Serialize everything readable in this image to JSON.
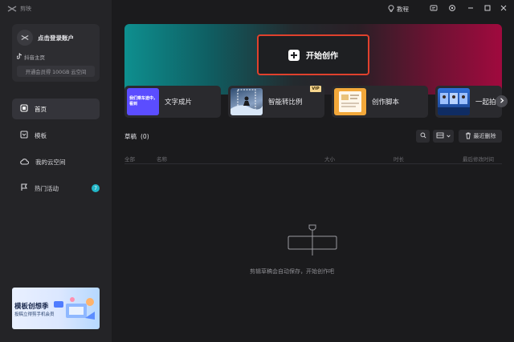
{
  "app": {
    "logo_text": "剪映"
  },
  "topbar": {
    "tutorial_label": "教程",
    "window_controls": [
      "minimize-icon",
      "maximize-icon",
      "close-icon"
    ]
  },
  "account": {
    "login_text": "点击登录账户",
    "douyin_label": "抖音主页",
    "vip_text": "开通会员得 100GB 云空间"
  },
  "nav": {
    "items": [
      {
        "label": "首页",
        "icon": "home-icon",
        "active": true
      },
      {
        "label": "模板",
        "icon": "template-icon",
        "active": false
      },
      {
        "label": "我的云空间",
        "icon": "cloud-icon",
        "active": false
      },
      {
        "label": "热门活动",
        "icon": "flag-icon",
        "active": false,
        "badge": "7"
      }
    ]
  },
  "promo": {
    "title": "模板创想季",
    "sub": "投稿立得剪手机会员"
  },
  "hero": {
    "create_label": "开始创作"
  },
  "features": [
    {
      "label": "文字成片",
      "thumb_text": "我们乘车途中，看到"
    },
    {
      "label": "智能转比例",
      "vip": "VIP"
    },
    {
      "label": "创作脚本"
    },
    {
      "label": "一起拍"
    }
  ],
  "drafts": {
    "title": "草稿",
    "count": "(0)",
    "recent_delete_label": "最近删除",
    "columns": {
      "all": "全部",
      "name": "名称",
      "size": "大小",
      "duration": "时长",
      "modified": "最后修改时间"
    },
    "empty_text": "剪辑草稿会自动保存，开始创作吧"
  },
  "colors": {
    "accent": "#22b7c8",
    "highlight_border": "#e0412d",
    "vip": "#f6d58e"
  }
}
